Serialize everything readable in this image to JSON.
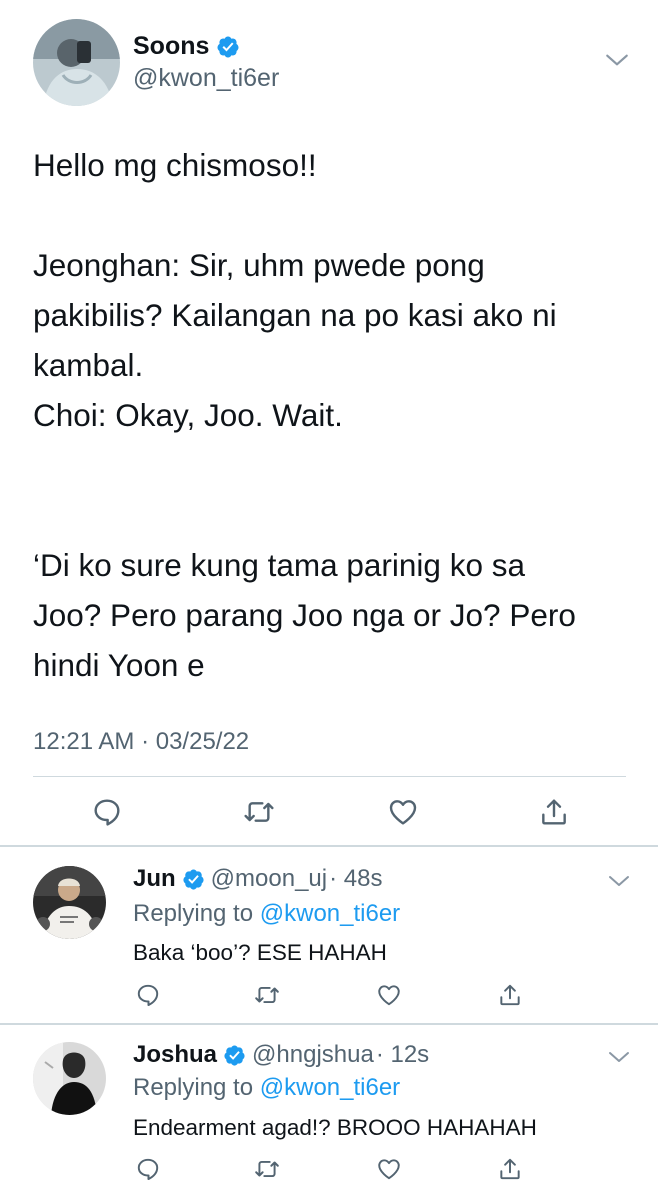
{
  "main_tweet": {
    "display_name": "Soons",
    "handle": "@kwon_ti6er",
    "verified": true,
    "text": "Hello mg chismoso!!\n\nJeonghan: Sir, uhm pwede pong\npakibilis? Kailangan na po kasi ako ni\nkambal.\nChoi: Okay, Joo. Wait.\n\n\n‘Di ko sure kung tama parinig ko sa\nJoo? Pero parang Joo nga or Jo? Pero\nhindi Yoon e",
    "timestamp": "12:21 AM · 03/25/22",
    "actions": [
      "reply-icon",
      "retweet-icon",
      "like-icon",
      "share-icon"
    ]
  },
  "replies": [
    {
      "display_name": "Jun",
      "handle": "@moon_uj",
      "time": "· 48s",
      "replying_prefix": "Replying to ",
      "replying_handle": "@kwon_ti6er",
      "text": "Baka ‘boo’? ESE HAHAH"
    },
    {
      "display_name": "Joshua",
      "handle": "@hngjshua",
      "time": "· 12s",
      "replying_prefix": "Replying to ",
      "replying_handle": "@kwon_ti6er",
      "text": "Endearment agad!? BROOO HAHAHAH"
    }
  ],
  "colors": {
    "verified": "#1d9bf0",
    "secondary_text": "#536471",
    "link": "#1d9bf0",
    "icon": "#536471"
  }
}
